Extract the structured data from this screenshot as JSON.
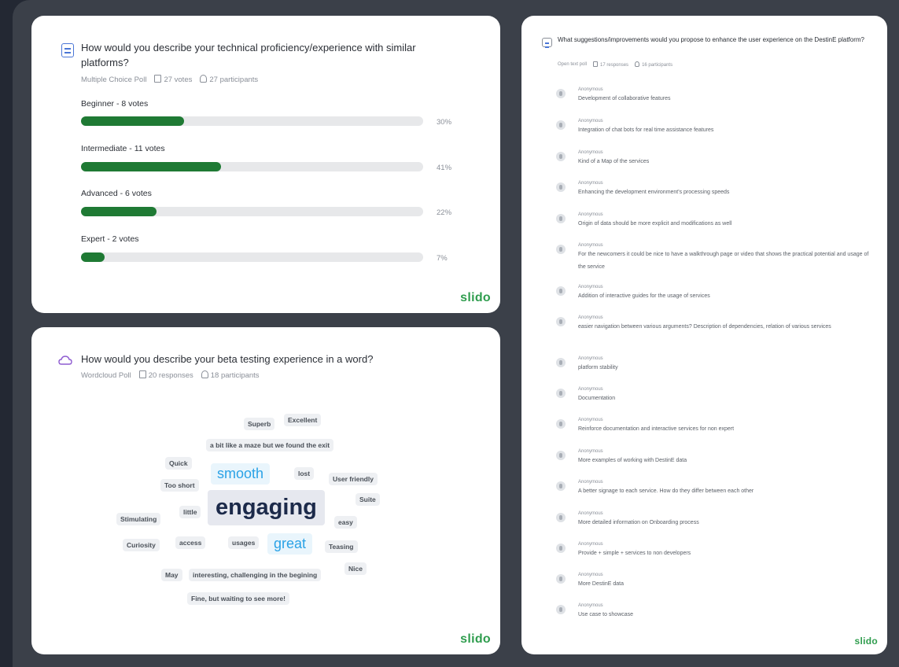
{
  "multiple_choice": {
    "question": "How would you describe your technical proficiency/experience with similar platforms?",
    "type_label": "Multiple Choice Poll",
    "votes": "27 votes",
    "participants": "27 participants",
    "options": [
      {
        "label": "Beginner - 8 votes",
        "percent_text": "30%",
        "fraction": 0.3
      },
      {
        "label": "Intermediate - 11 votes",
        "percent_text": "41%",
        "fraction": 0.41
      },
      {
        "label": "Advanced - 6 votes",
        "percent_text": "22%",
        "fraction": 0.22
      },
      {
        "label": "Expert - 2 votes",
        "percent_text": "7%",
        "fraction": 0.07
      }
    ],
    "brand": "slido"
  },
  "wordcloud": {
    "question": "How would you describe your beta testing experience in a word?",
    "type_label": "Wordcloud Poll",
    "responses": "20 responses",
    "participants": "18 participants",
    "words": [
      {
        "text": "Superb",
        "weight": 1
      },
      {
        "text": "Excellent",
        "weight": 1
      },
      {
        "text": "a bit like a maze but we found the exit",
        "weight": 1
      },
      {
        "text": "Quick",
        "weight": 1
      },
      {
        "text": "smooth",
        "weight": 2
      },
      {
        "text": "lost",
        "weight": 1
      },
      {
        "text": "Too short",
        "weight": 1
      },
      {
        "text": "User friendly",
        "weight": 1
      },
      {
        "text": "Suite",
        "weight": 1
      },
      {
        "text": "Stimulating",
        "weight": 1
      },
      {
        "text": "little",
        "weight": 1
      },
      {
        "text": "engaging",
        "weight": 3
      },
      {
        "text": "easy",
        "weight": 1
      },
      {
        "text": "Curiosity",
        "weight": 1
      },
      {
        "text": "access",
        "weight": 1
      },
      {
        "text": "usages",
        "weight": 1
      },
      {
        "text": "great",
        "weight": 2
      },
      {
        "text": "Teasing",
        "weight": 1
      },
      {
        "text": "Nice",
        "weight": 1
      },
      {
        "text": "May",
        "weight": 1
      },
      {
        "text": "interesting, challenging in the begining",
        "weight": 1
      },
      {
        "text": "Fine, but waiting to see more!",
        "weight": 1
      }
    ],
    "brand": "slido"
  },
  "open_text": {
    "question": "What suggestions/improvements would you propose to enhance the user experience on the DestinE platform?",
    "type_label": "Open text poll",
    "responses": "17 responses",
    "participants": "16 participants",
    "items": [
      {
        "author": "Anonymous",
        "text": "Development of collaborative features"
      },
      {
        "author": "Anonymous",
        "text": "Integration of chat bots for real time assistance features"
      },
      {
        "author": "Anonymous",
        "text": "Kind of a Map of the services"
      },
      {
        "author": "Anonymous",
        "text": "Enhancing the development environment's processing speeds"
      },
      {
        "author": "Anonymous",
        "text": "Origin of data should be more explicit and modifications as well"
      },
      {
        "author": "Anonymous",
        "text": "For the newcomers it could be nice to have a walkthrough page or video that shows the practical potential and usage of the service"
      },
      {
        "author": "Anonymous",
        "text": "Addition of interactive guides for the usage of services"
      },
      {
        "author": "Anonymous",
        "text": "easier navigation between various arguments? Description of dependencies, relation of various services"
      },
      {
        "author": "Anonymous",
        "text": "platform stability"
      },
      {
        "author": "Anonymous",
        "text": "Documentation"
      },
      {
        "author": "Anonymous",
        "text": "Reinforce documentation and interactive services for non expert"
      },
      {
        "author": "Anonymous",
        "text": "More examples of working with DestinE data"
      },
      {
        "author": "Anonymous",
        "text": "A better signage to each service. How do they differ between each other"
      },
      {
        "author": "Anonymous",
        "text": "More detailed information on Onboarding process"
      },
      {
        "author": "Anonymous",
        "text": "Provide + simple + services to non developers"
      },
      {
        "author": "Anonymous",
        "text": "More DestinE data"
      },
      {
        "author": "Anonymous",
        "text": "Use case to showcase"
      }
    ],
    "brand": "slido"
  },
  "colors": {
    "bar": "#1f7a34",
    "brand": "#2f9d4e",
    "accent": "#2aa2e6"
  }
}
